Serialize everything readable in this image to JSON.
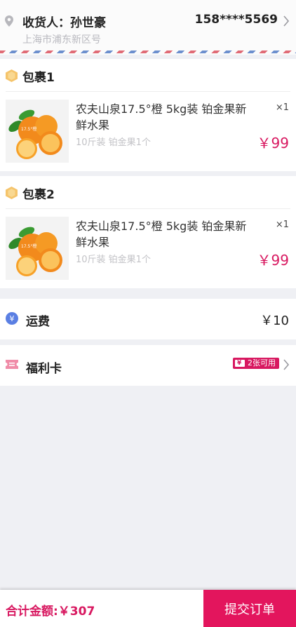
{
  "address": {
    "receiver_label": "收货人：孙世豪",
    "phone": "158****5569",
    "address": "上海市浦东新区号"
  },
  "packages": [
    {
      "title": "包裹1",
      "product_name": "农夫山泉17.5°橙 5kg装 铂金果新鲜水果",
      "spec": "10斤装 铂金果1个",
      "quantity": "×1",
      "price": "￥99",
      "image_label": "17.5°橙"
    },
    {
      "title": "包裹2",
      "product_name": "农夫山泉17.5°橙 5kg装 铂金果新鲜水果",
      "spec": "10斤装 铂金果1个",
      "quantity": "×1",
      "price": "￥99",
      "image_label": "17.5°橙"
    }
  ],
  "shipping": {
    "label": "运费",
    "value": "￥10",
    "icon": "yen-coin-icon"
  },
  "welfare_card": {
    "label": "福利卡",
    "badge": "2张可用",
    "icon": "ticket-icon"
  },
  "footer": {
    "total": "合计金额:￥307",
    "submit_label": "提交订单"
  },
  "colors": {
    "accent": "#d81860",
    "submit_bg": "#e3155d",
    "package_icon": "#f5c46b",
    "shipping_icon": "#5a7fe3",
    "ticket_icon": "#f08ca8"
  }
}
